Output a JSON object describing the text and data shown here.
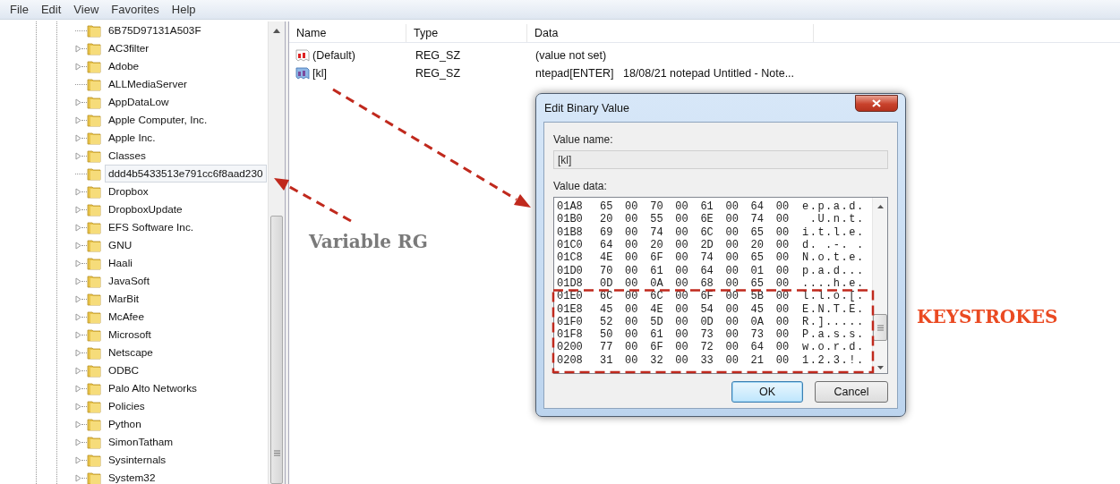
{
  "menu": [
    {
      "label": "File"
    },
    {
      "label": "Edit"
    },
    {
      "label": "View"
    },
    {
      "label": "Favorites"
    },
    {
      "label": "Help"
    }
  ],
  "tree": {
    "items": [
      {
        "label": "6B75D97131A503F",
        "expandable": false,
        "selected": false
      },
      {
        "label": "AC3filter",
        "expandable": true,
        "selected": false
      },
      {
        "label": "Adobe",
        "expandable": true,
        "selected": false
      },
      {
        "label": "ALLMediaServer",
        "expandable": false,
        "selected": false
      },
      {
        "label": "AppDataLow",
        "expandable": true,
        "selected": false
      },
      {
        "label": "Apple Computer, Inc.",
        "expandable": true,
        "selected": false
      },
      {
        "label": "Apple Inc.",
        "expandable": true,
        "selected": false
      },
      {
        "label": "Classes",
        "expandable": true,
        "selected": false
      },
      {
        "label": "ddd4b5433513e791cc6f8aad230",
        "expandable": false,
        "selected": true
      },
      {
        "label": "Dropbox",
        "expandable": true,
        "selected": false
      },
      {
        "label": "DropboxUpdate",
        "expandable": true,
        "selected": false
      },
      {
        "label": "EFS Software Inc.",
        "expandable": true,
        "selected": false
      },
      {
        "label": "GNU",
        "expandable": true,
        "selected": false
      },
      {
        "label": "Haali",
        "expandable": true,
        "selected": false
      },
      {
        "label": "JavaSoft",
        "expandable": true,
        "selected": false
      },
      {
        "label": "MarBit",
        "expandable": true,
        "selected": false
      },
      {
        "label": "McAfee",
        "expandable": true,
        "selected": false
      },
      {
        "label": "Microsoft",
        "expandable": true,
        "selected": false
      },
      {
        "label": "Netscape",
        "expandable": true,
        "selected": false
      },
      {
        "label": "ODBC",
        "expandable": true,
        "selected": false
      },
      {
        "label": "Palo Alto Networks",
        "expandable": true,
        "selected": false
      },
      {
        "label": "Policies",
        "expandable": true,
        "selected": false
      },
      {
        "label": "Python",
        "expandable": true,
        "selected": false
      },
      {
        "label": "SimonTatham",
        "expandable": true,
        "selected": false
      },
      {
        "label": "Sysinternals",
        "expandable": true,
        "selected": false
      },
      {
        "label": "System32",
        "expandable": true,
        "selected": false
      }
    ]
  },
  "values": {
    "columns": [
      {
        "label": "Name"
      },
      {
        "label": "Type"
      },
      {
        "label": "Data"
      }
    ],
    "rows": [
      {
        "name": "(Default)",
        "type": "REG_SZ",
        "data": "(value not set)",
        "selected": false
      },
      {
        "name": "[kl]",
        "type": "REG_SZ",
        "data": "ntepad[ENTER]   18/08/21 notepad Untitled - Note...",
        "selected": true
      }
    ]
  },
  "dialog": {
    "title": "Edit Binary Value",
    "value_name_label": "Value name:",
    "value_name": "[kl]",
    "value_data_label": "Value data:",
    "hex_rows": [
      {
        "address": "01A8",
        "bytes": "65 00 70 00 61 00 64 00",
        "ascii": "e.p.a.d."
      },
      {
        "address": "01B0",
        "bytes": "20 00 55 00 6E 00 74 00",
        "ascii": " .U.n.t."
      },
      {
        "address": "01B8",
        "bytes": "69 00 74 00 6C 00 65 00",
        "ascii": "i.t.l.e."
      },
      {
        "address": "01C0",
        "bytes": "64 00 20 00 2D 00 20 00",
        "ascii": "d. .-. ."
      },
      {
        "address": "01C8",
        "bytes": "4E 00 6F 00 74 00 65 00",
        "ascii": "N.o.t.e."
      },
      {
        "address": "01D0",
        "bytes": "70 00 61 00 64 00 01 00",
        "ascii": "p.a.d..."
      },
      {
        "address": "01D8",
        "bytes": "0D 00 0A 00 68 00 65 00",
        "ascii": "....h.e."
      },
      {
        "address": "01E0",
        "bytes": "6C 00 6C 00 6F 00 5B 00",
        "ascii": "l.l.o.[."
      },
      {
        "address": "01E8",
        "bytes": "45 00 4E 00 54 00 45 00",
        "ascii": "E.N.T.E."
      },
      {
        "address": "01F0",
        "bytes": "52 00 5D 00 0D 00 0A 00",
        "ascii": "R.]....."
      },
      {
        "address": "01F8",
        "bytes": "50 00 61 00 73 00 73 00",
        "ascii": "P.a.s.s."
      },
      {
        "address": "0200",
        "bytes": "77 00 6F 00 72 00 64 00",
        "ascii": "w.o.r.d."
      },
      {
        "address": "0208",
        "bytes": "31 00 32 00 33 00 21 00",
        "ascii": "1.2.3.!."
      }
    ],
    "buttons": [
      {
        "label": "OK",
        "default": true
      },
      {
        "label": "Cancel",
        "default": false
      }
    ]
  },
  "annotations": {
    "label": "Variable RG",
    "callout": "KEYSTROKES"
  }
}
